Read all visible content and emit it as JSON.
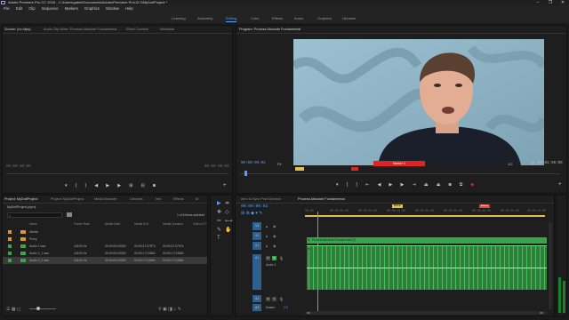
{
  "window": {
    "title": "Adobe Premiere Pro CC 2018 - C:\\Users\\gabel\\Documents\\Adobe\\Premiere Pro\\12.0\\MyDollProject *",
    "controls": [
      "–",
      "❐",
      "✕"
    ]
  },
  "menu": [
    "File",
    "Edit",
    "Clip",
    "Sequence",
    "Markers",
    "Graphics",
    "Window",
    "Help"
  ],
  "workspaces": [
    {
      "label": "Learning",
      "active": false
    },
    {
      "label": "Assembly",
      "active": false
    },
    {
      "label": "Editing",
      "active": true
    },
    {
      "label": "Color",
      "active": false
    },
    {
      "label": "Effects",
      "active": false
    },
    {
      "label": "Audio",
      "active": false
    },
    {
      "label": "Graphics",
      "active": false
    },
    {
      "label": "Libraries",
      "active": false
    }
  ],
  "source_panel": {
    "tabs": [
      "Source: (no clips)",
      "Audio Clip Mixer: Process Absolute Fundamental",
      "Effect Controls",
      "Metadata"
    ],
    "timecode_left": "00:00:00:00",
    "timecode_right": "00:00:00:00"
  },
  "program_panel": {
    "tab": "Program: Process Absolute Fundamental",
    "timecode_left": "00:00:00:02",
    "zoom": "Fit",
    "fraction": "1/2",
    "timecode_right": "00:01:06:09",
    "marker_label": "Marker 1"
  },
  "project_panel": {
    "tabs": [
      "Project: MyDollProject",
      "Project: MyDollProject",
      "Media Browser",
      "Libraries",
      "Info",
      "Effects",
      "M"
    ],
    "path": "MyDollProject.prproj",
    "selection_info": "1 of 5 items selected",
    "columns": [
      "Name",
      "Frame Rate",
      "Media Start",
      "Media End",
      "Media Duration",
      "Video In P"
    ],
    "rows": [
      {
        "name": "Abetta",
        "type": "folder",
        "color": "#d79a24",
        "frame_rate": "",
        "media_start": "",
        "media_end": "",
        "media_duration": ""
      },
      {
        "name": "Proxy",
        "type": "folder",
        "color": "#d79a24",
        "frame_rate": "",
        "media_start": "",
        "media_end": "",
        "media_duration": ""
      },
      {
        "name": "Audio 1.wav",
        "type": "audio",
        "color": "#3fa34d",
        "frame_rate": "44100 Hz",
        "media_start": "00:00:00:00000",
        "media_end": "00:00:37:07573",
        "media_duration": "00:00:37:07574"
      },
      {
        "name": "Audio 2_1.wav",
        "type": "audio",
        "color": "#3fa34d",
        "frame_rate": "44100 Hz",
        "media_start": "00:00:00:00000",
        "media_end": "00:00:17:24863",
        "media_duration": "00:00:17:24864"
      },
      {
        "name": "Audio 2_2.wav",
        "type": "audio",
        "color": "#3fa34d",
        "frame_rate": "44100 Hz",
        "media_start": "00:00:00:00000",
        "media_end": "00:00:17:24863",
        "media_duration": "00:00:17:24864"
      }
    ]
  },
  "tools": [
    "▶",
    "⇹",
    "✥",
    "◇",
    "✂",
    "⟷",
    "✎",
    "✋",
    "T"
  ],
  "timeline": {
    "tabs": [
      "Intro to Sync Pixel Director",
      "Process Absolute Fundamental"
    ],
    "timecode": "00:00:00:02",
    "ruler": [
      "00:00",
      "00:00:05:00",
      "00:00:10:00",
      "00:00:15:00",
      "00:00:20:00",
      "00:00:25:00",
      "00:00:30:00",
      "00:00:35:00",
      "00:00:40:00",
      "00:00:45:00"
    ],
    "markers": [
      {
        "label": "Marker",
        "color": "#e0c050"
      },
      {
        "label": "Marker",
        "color": "#e04848"
      }
    ],
    "tracks": [
      {
        "label": "V3"
      },
      {
        "label": "V2"
      },
      {
        "label": "V1"
      },
      {
        "label": "A1"
      },
      {
        "label": "A2"
      },
      {
        "label": "A3"
      }
    ],
    "video_clip_label": "Process Absolute Fundamental [V]",
    "audio_label": "Audio 1",
    "master_label": "Master",
    "master_value": "0.0"
  },
  "colors": {
    "accent": "#4a9fff",
    "clip_green": "#37a54b",
    "marker_red": "#e02424"
  },
  "icons": [
    "add-marker-icon",
    "mark-in-icon",
    "mark-out-icon",
    "step-back-icon",
    "play-icon",
    "step-forward-icon",
    "lift-icon",
    "extract-icon",
    "camera-icon",
    "wrench-icon",
    "selection-tool-icon",
    "razor-tool-icon",
    "hand-tool-icon",
    "type-tool-icon",
    "folder-icon",
    "audio-clip-icon",
    "mute-icon",
    "solo-icon",
    "lock-icon",
    "eye-icon",
    "mic-icon"
  ]
}
